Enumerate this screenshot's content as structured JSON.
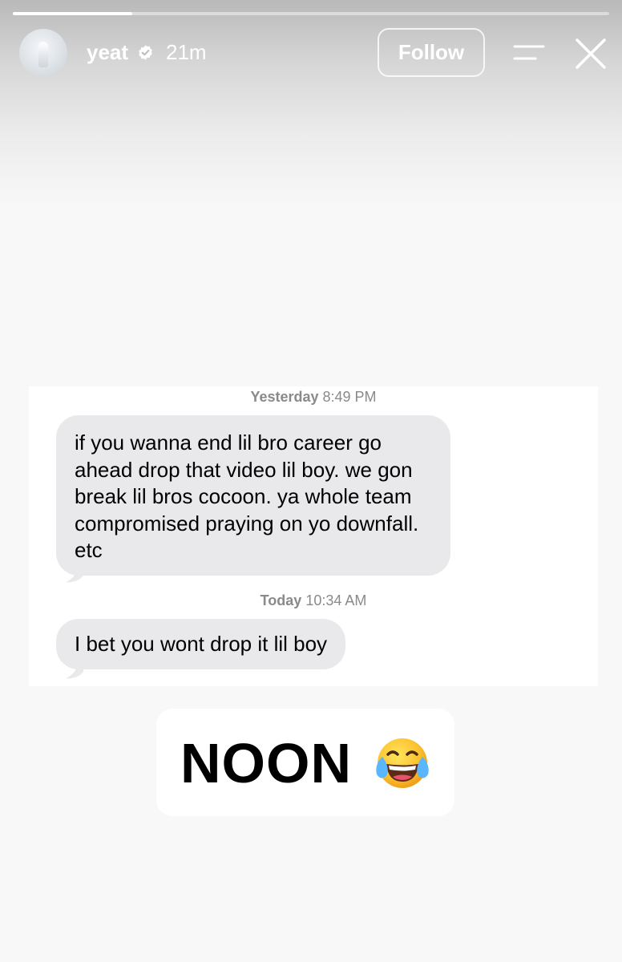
{
  "story_header": {
    "username": "yeat",
    "verified": true,
    "time_ago": "21m",
    "follow_label": "Follow",
    "progress": 0.2
  },
  "conversation": {
    "timestamp_1": {
      "day": "Yesterday",
      "time": "8:49 PM"
    },
    "message_1": "if you wanna end lil bro career go ahead drop that video lil boy. we gon break lil bros cocoon. ya whole team compromised praying on yo downfall. etc",
    "timestamp_2": {
      "day": "Today",
      "time": "10:34 AM"
    },
    "message_2": "I bet you wont drop it lil boy"
  },
  "sticker": {
    "text": "NOON",
    "emoji": "face-with-tears-of-joy"
  },
  "colors": {
    "bubble": "#e9e9eb",
    "timestamp": "#8a8a8e",
    "background": "#f8f8f8"
  }
}
